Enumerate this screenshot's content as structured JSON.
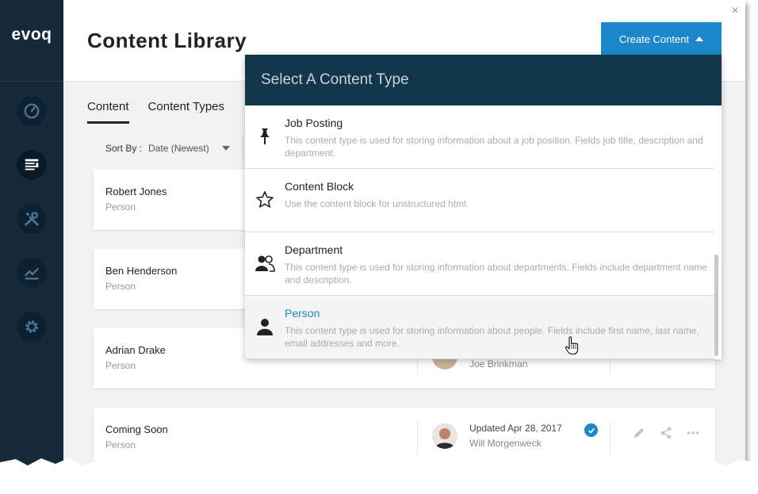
{
  "app": {
    "logo": "evoq",
    "page_title": "Content Library",
    "close_label": "×"
  },
  "header": {
    "create_button_label": "Create Content"
  },
  "tabs": [
    {
      "label": "Content",
      "active": true
    },
    {
      "label": "Content Types",
      "active": false
    }
  ],
  "sort": {
    "label": "Sort By :",
    "value": "Date (Newest)"
  },
  "sidebar": {
    "items": [
      {
        "icon": "dashboard-icon"
      },
      {
        "icon": "content-icon"
      },
      {
        "icon": "tools-icon"
      },
      {
        "icon": "analytics-icon"
      },
      {
        "icon": "settings-icon"
      }
    ]
  },
  "cards": [
    {
      "name": "Robert Jones",
      "type": "Person"
    },
    {
      "name": "Ben Henderson",
      "type": "Person"
    },
    {
      "name": "Adrian Drake",
      "type": "Person",
      "author": "Joe Brinkman"
    },
    {
      "name": "Coming Soon",
      "type": "Person",
      "updated": "Updated Apr 28, 2017",
      "author": "Will Morgenweck"
    }
  ],
  "dropdown": {
    "header": "Select A Content Type",
    "items": [
      {
        "title": "Job Posting",
        "icon": "pushpin-icon",
        "desc": "This content type is used for storing information about a job position. Fields job title, description and department."
      },
      {
        "title": "Content Block",
        "icon": "star-icon",
        "desc": "Use the content block for unstructured html."
      },
      {
        "title": "Department",
        "icon": "group-icon",
        "desc": "This content type is used for storing information about departments. Fields include department name and description."
      },
      {
        "title": "Person",
        "icon": "person-icon",
        "desc": "This content type is used for storing information about people. Fields include first name, last name, email addresses and more."
      }
    ]
  },
  "colors": {
    "sidebar": "#152b3a",
    "accent": "#1c87c9",
    "dropdown_header": "#12374a"
  }
}
